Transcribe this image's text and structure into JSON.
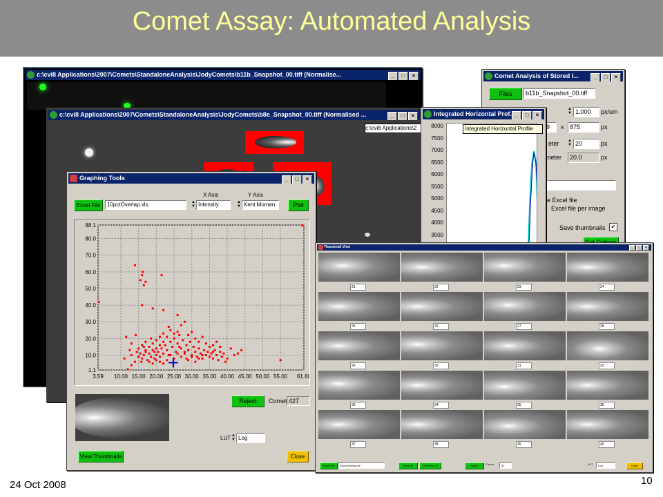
{
  "slide": {
    "title": "Comet Assay: Automated Analysis",
    "date": "24 Oct 2008",
    "page_number": "10"
  },
  "window_back": {
    "title": "c:\\cvi8 Applications\\2007\\Comets\\StandaloneAnalysis\\JodyComets\\b11b_Snapshot_00.tiff (Normalise..."
  },
  "window_mid": {
    "title": "c:\\cvi8 Applications\\2007\\Comets\\StandaloneAnalysis\\JodyComets\\b8e_Snapshot_00.tiff (Normalised ...",
    "path_tooltip": "c:\\cvi8 Applications\\2"
  },
  "comet_analysis": {
    "title": "Comet Analysis of Stored I...",
    "files_button": "Files",
    "file_name": "b11b_Snapshot_00.tiff",
    "scale_value": "1.000",
    "scale_unit": "px/um",
    "width_value": "9",
    "x_sep": "x",
    "height_value": "875",
    "size_unit": "px",
    "param1_label": "eter",
    "param1_value": "20",
    "param1_unit": "px",
    "param2_label": "meter",
    "param2_value": "20.0",
    "param2_unit": "px",
    "option1": "le Excel file",
    "option2": "Excel file per image",
    "save_thumbs_label": "Save thumbnails",
    "save_thumbs_check": "✔",
    "set_criteria_button": "Set Criteria"
  },
  "profile_window": {
    "title": "Integrated Horizontal Prof...",
    "tooltip": "Integrated Horizontal Profile",
    "y_ticks": [
      "8000",
      "7500",
      "7000",
      "6500",
      "6000",
      "5500",
      "5000",
      "4500",
      "4000",
      "3500"
    ]
  },
  "graphing_tools": {
    "title": "Graphing Tools",
    "excel_button": "Excel File",
    "excel_file": "10pctOverlap.xls",
    "x_axis_label": "X Axis",
    "x_axis_value": "Intensity",
    "y_axis_label": "Y Axis",
    "y_axis_value": "Kent Momen",
    "plot_button": "Plot",
    "reject_button": "Reject",
    "comet_label": "Comet",
    "comet_value": "427",
    "lut_label": "LUT",
    "lut_value": "Log",
    "view_thumbs_button": "View Thumbnails",
    "close_button": "Close"
  },
  "chart_data": {
    "type": "scatter",
    "title": "",
    "xlabel": "",
    "ylabel": "",
    "xlim": [
      3.59,
      61.6
    ],
    "ylim": [
      1.1,
      88.1
    ],
    "x_ticks": [
      "3.59",
      "10.00",
      "15.00",
      "20.00",
      "25.00",
      "30.00",
      "35.00",
      "40.00",
      "45.00",
      "50.00",
      "55.00",
      "61.60"
    ],
    "y_ticks": [
      "88.1",
      "80.0",
      "70.0",
      "60.0",
      "50.0",
      "40.0",
      "30.0",
      "20.0",
      "10.0",
      "1.1"
    ],
    "grid": true,
    "series": [
      {
        "color": "#ff0000",
        "points": [
          [
            3.8,
            42
          ],
          [
            12,
            1.5
          ],
          [
            11,
            8
          ],
          [
            13,
            4
          ],
          [
            14,
            64
          ],
          [
            15.5,
            55
          ],
          [
            16,
            58
          ],
          [
            16.5,
            52
          ],
          [
            16.2,
            60
          ],
          [
            17,
            54
          ],
          [
            21.5,
            58
          ],
          [
            19,
            38
          ],
          [
            22,
            37
          ],
          [
            16,
            40
          ],
          [
            11.5,
            21
          ],
          [
            13,
            17
          ],
          [
            14.5,
            12
          ],
          [
            15,
            9
          ],
          [
            15.5,
            11
          ],
          [
            16,
            8
          ],
          [
            16.5,
            10
          ],
          [
            17,
            12
          ],
          [
            17.5,
            7
          ],
          [
            18,
            11
          ],
          [
            18.5,
            9
          ],
          [
            19,
            13
          ],
          [
            19.5,
            8
          ],
          [
            20,
            10
          ],
          [
            20.5,
            12
          ],
          [
            21,
            9
          ],
          [
            21.5,
            14
          ],
          [
            22,
            11
          ],
          [
            22.5,
            16
          ],
          [
            23,
            13
          ],
          [
            23.5,
            10
          ],
          [
            24,
            18
          ],
          [
            24.5,
            15
          ],
          [
            25,
            20
          ],
          [
            25.5,
            12
          ],
          [
            26,
            17
          ],
          [
            26.5,
            22
          ],
          [
            27,
            14
          ],
          [
            27.5,
            19
          ],
          [
            28,
            11
          ],
          [
            28.5,
            16
          ],
          [
            29,
            13
          ],
          [
            29.5,
            18
          ],
          [
            30,
            10
          ],
          [
            30.5,
            15
          ],
          [
            31,
            12
          ],
          [
            31.5,
            9
          ],
          [
            32,
            14
          ],
          [
            32.5,
            11
          ],
          [
            33,
            8
          ],
          [
            33.5,
            13
          ],
          [
            34,
            10
          ],
          [
            34.5,
            12
          ],
          [
            35,
            9
          ],
          [
            35.5,
            11
          ],
          [
            36,
            8
          ],
          [
            36.5,
            13
          ],
          [
            37,
            10
          ],
          [
            37.5,
            7
          ],
          [
            38,
            12
          ],
          [
            38.5,
            9
          ],
          [
            39,
            11
          ],
          [
            40,
            8
          ],
          [
            41,
            14
          ],
          [
            42,
            10
          ],
          [
            43,
            11
          ],
          [
            44,
            13
          ],
          [
            17,
            13
          ],
          [
            18,
            15
          ],
          [
            19,
            17
          ],
          [
            20,
            19
          ],
          [
            21,
            21
          ],
          [
            22,
            23
          ],
          [
            23,
            21
          ],
          [
            24,
            25
          ],
          [
            25,
            23
          ],
          [
            26,
            24
          ],
          [
            18,
            6
          ],
          [
            19,
            5
          ],
          [
            20,
            7
          ],
          [
            21,
            6
          ],
          [
            22,
            5
          ],
          [
            23,
            7
          ],
          [
            15,
            14
          ],
          [
            16,
            16
          ],
          [
            17,
            18
          ],
          [
            14,
            6
          ],
          [
            13,
            10
          ],
          [
            12.5,
            13
          ],
          [
            27,
            28
          ],
          [
            28,
            30
          ],
          [
            26,
            34
          ],
          [
            29,
            22
          ],
          [
            30,
            24
          ],
          [
            31,
            20
          ],
          [
            32,
            18
          ],
          [
            33,
            21
          ],
          [
            34,
            17
          ],
          [
            35,
            15
          ],
          [
            36,
            16
          ],
          [
            37,
            18
          ],
          [
            24,
            10
          ],
          [
            25,
            8
          ],
          [
            26,
            11
          ],
          [
            27,
            9
          ],
          [
            28,
            12
          ],
          [
            29,
            7
          ],
          [
            30,
            9
          ],
          [
            31,
            6
          ],
          [
            32,
            8
          ],
          [
            33,
            10
          ],
          [
            20,
            14
          ],
          [
            21,
            16
          ],
          [
            22,
            18
          ],
          [
            14.2,
            22
          ],
          [
            23.5,
            27
          ],
          [
            55,
            7
          ],
          [
            61.2,
            88
          ],
          [
            18.5,
            20
          ],
          [
            19.5,
            12
          ],
          [
            16.5,
            15
          ],
          [
            15.8,
            6
          ],
          [
            26.5,
            15
          ],
          [
            28.5,
            8
          ],
          [
            36,
            12
          ],
          [
            38,
            15
          ],
          [
            39.5,
            6
          ]
        ]
      }
    ],
    "marker": {
      "x": 24.8,
      "y": 5.5,
      "color": "#0000cc"
    }
  },
  "thumbnail_view": {
    "title": "Thumbnail View",
    "numbers": [
      "21",
      "22",
      "23",
      "24",
      "25",
      "26",
      "27",
      "28",
      "29",
      "30",
      "31",
      "32",
      "33",
      "34",
      "35",
      "36",
      "37",
      "38",
      "39",
      "40"
    ],
    "excel_button": "Excel File",
    "excel_file": "10pctOverlap.xls",
    "next_button": "Next 20",
    "prev_button": "Previous 20",
    "reject_button": "Reject",
    "comet_label": "Comet",
    "comet_value": "32",
    "lut_label": "LUT",
    "lut_value": "Log",
    "close_button": "Close"
  }
}
